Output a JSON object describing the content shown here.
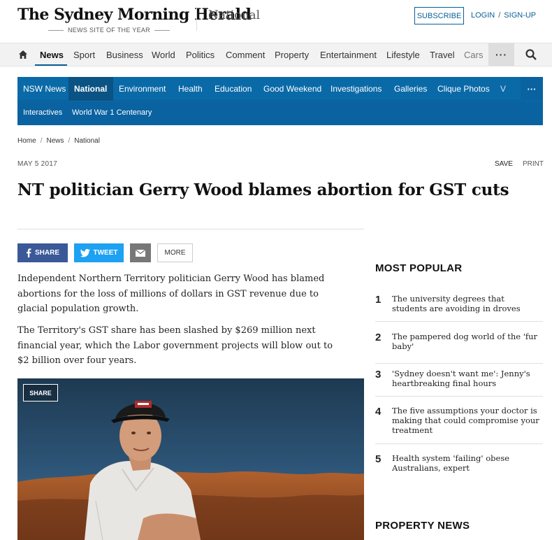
{
  "masthead": {
    "logo": "The Sydney Morning Herald",
    "tagline": "NEWS SITE OF THE YEAR",
    "section": "National",
    "subscribe": "SUBSCRIBE",
    "login": "LOGIN",
    "separator": "/",
    "signup": "SIGN-UP",
    "brand_color": "#0a5f97"
  },
  "primary_nav": {
    "items": [
      "News",
      "Sport",
      "Business",
      "World",
      "Politics",
      "Comment",
      "Property",
      "Entertainment",
      "Lifestyle",
      "Travel",
      "Cars"
    ],
    "active": "News",
    "more": "···"
  },
  "section_nav": {
    "items": [
      "NSW News",
      "National",
      "Environment",
      "Health",
      "Education",
      "Good Weekend",
      "Investigations",
      "Galleries",
      "Clique Photos",
      "V"
    ],
    "active": "National",
    "more": "···",
    "sub_items": [
      "Interactives",
      "World War 1 Centenary"
    ],
    "color": "#0a6aa8"
  },
  "breadcrumb": [
    "Home",
    "News",
    "National"
  ],
  "article": {
    "date": "MAY 5 2017",
    "save": "SAVE",
    "print": "PRINT",
    "headline": "NT politician Gerry Wood blames abortion for GST cuts",
    "share": {
      "facebook": "SHARE",
      "twitter": "TWEET",
      "more": "MORE"
    },
    "paragraphs": [
      "Independent Northern Territory politician Gerry Wood has blamed abortions for the loss of millions of dollars in GST revenue due to glacial population growth.",
      "The Territory's GST share has been slashed by $269 million next financial year, which the Labor government projects will blow out to $2 billion over four years."
    ],
    "image_share": "SHARE"
  },
  "most_popular": {
    "title": "MOST POPULAR",
    "items": [
      {
        "rank": "1",
        "text": "The university degrees that students are avoiding in droves"
      },
      {
        "rank": "2",
        "text": "The pampered dog world of the 'fur baby'"
      },
      {
        "rank": "3",
        "text": "'Sydney doesn't want me': Jenny's heartbreaking final hours"
      },
      {
        "rank": "4",
        "text": "The five assumptions your doctor is making that could compromise your treatment"
      },
      {
        "rank": "5",
        "text": "Health system 'failing' obese Australians, expert"
      }
    ]
  },
  "property_news": {
    "title": "PROPERTY NEWS"
  }
}
